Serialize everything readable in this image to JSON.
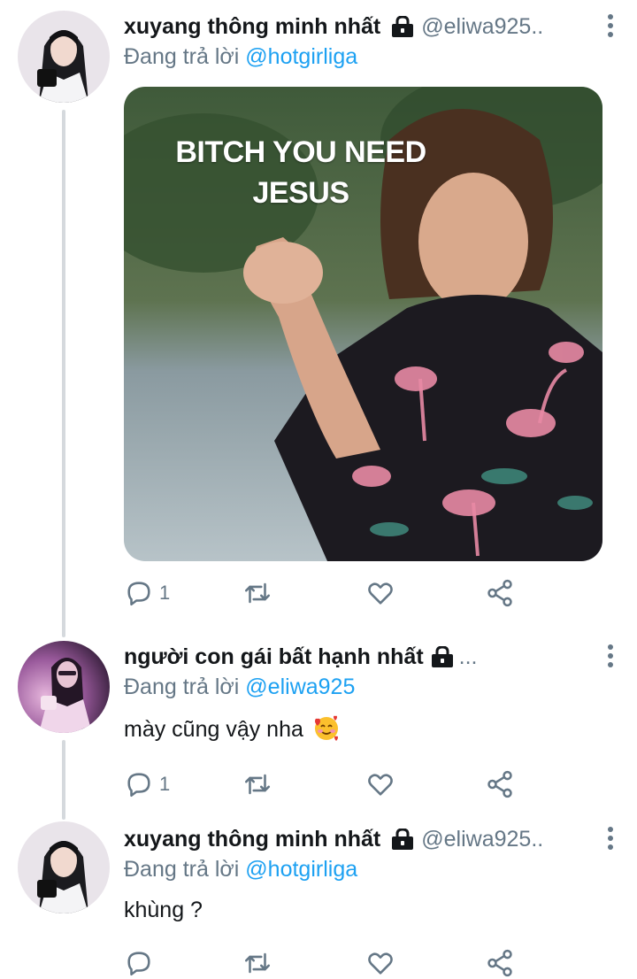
{
  "tweets": [
    {
      "display_name": "xuyang thông minh nhất",
      "handle": "@eliwa925..",
      "reply_prefix": "Đang trả lời",
      "reply_to": "@hotgirliga",
      "text": "",
      "media": {
        "caption_line1": "BITCH YOU NEED",
        "caption_line2": "JESUS"
      },
      "reply_count": "1",
      "retweet_count": "",
      "like_count": ""
    },
    {
      "display_name": "người con gái bất hạnh nhất",
      "handle": "...",
      "reply_prefix": "Đang trả lời",
      "reply_to": "@eliwa925",
      "text": "mày cũng vậy nha",
      "emoji": "smiling-face-with-hearts",
      "reply_count": "1",
      "retweet_count": "",
      "like_count": ""
    },
    {
      "display_name": "xuyang thông minh nhất",
      "handle": "@eliwa925..",
      "reply_prefix": "Đang trả lời",
      "reply_to": "@hotgirliga",
      "text": "khùng ?",
      "reply_count": "",
      "retweet_count": "",
      "like_count": ""
    }
  ],
  "icons": {
    "lock": "lock-icon",
    "more": "more-vertical-icon",
    "reply": "reply-icon",
    "retweet": "retweet-icon",
    "like": "heart-icon",
    "share": "share-icon"
  },
  "colors": {
    "text_primary": "#14171a",
    "text_secondary": "#657786",
    "mention": "#1da1f2",
    "thread_line": "#d5d9dd"
  }
}
